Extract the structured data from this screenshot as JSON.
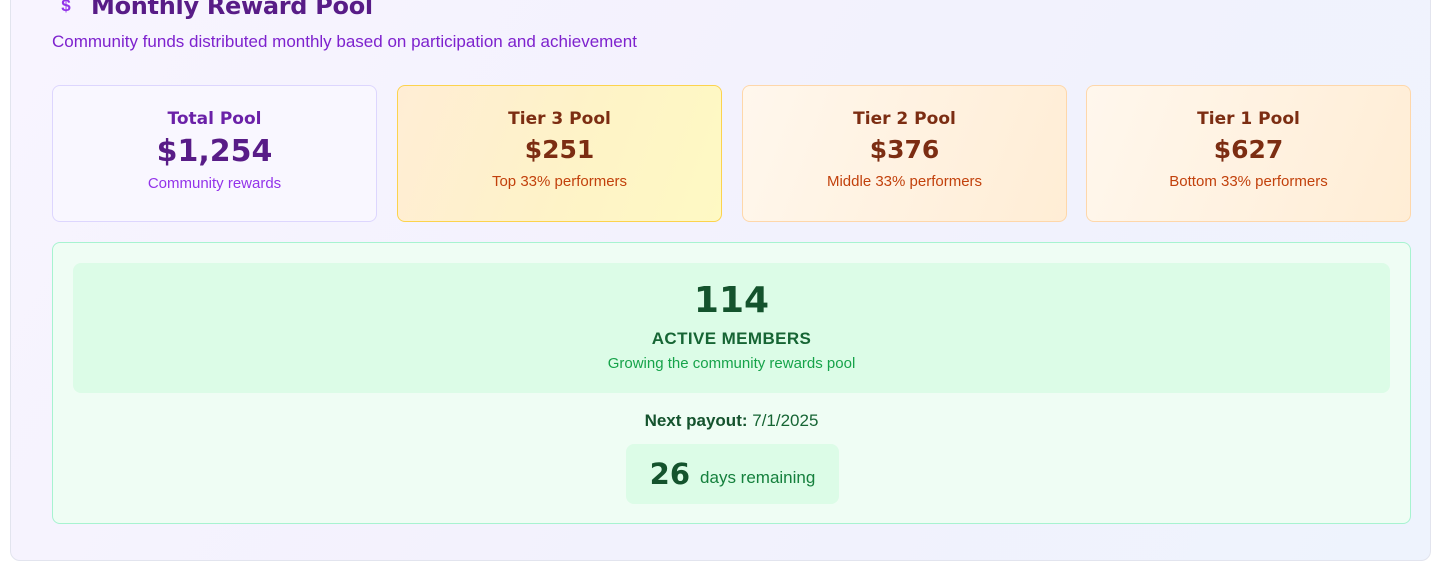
{
  "header": {
    "icon": "dollar-icon",
    "title": "Monthly Reward Pool",
    "subtitle": "Community funds distributed monthly based on participation and achievement"
  },
  "pools": {
    "total": {
      "label": "Total Pool",
      "value": "$1,254",
      "sub": "Community rewards"
    },
    "tier3": {
      "label": "Tier 3 Pool",
      "value": "$251",
      "sub": "Top 33% performers"
    },
    "tier2": {
      "label": "Tier 2 Pool",
      "value": "$376",
      "sub": "Middle 33% performers"
    },
    "tier1": {
      "label": "Tier 1 Pool",
      "value": "$627",
      "sub": "Bottom 33% performers"
    }
  },
  "members": {
    "count": "114",
    "label": "ACTIVE MEMBERS",
    "sub": "Growing the community rewards pool"
  },
  "payout": {
    "label": "Next payout:",
    "date": "7/1/2025",
    "days": "26",
    "days_text": "days remaining"
  },
  "colors": {
    "brand_purple": "#581c87",
    "accent_purple": "#9333ea",
    "tier_brown": "#7c2d12",
    "tier_orange": "#c2410c",
    "green_dark": "#14532d",
    "green_accent": "#16a34a"
  }
}
